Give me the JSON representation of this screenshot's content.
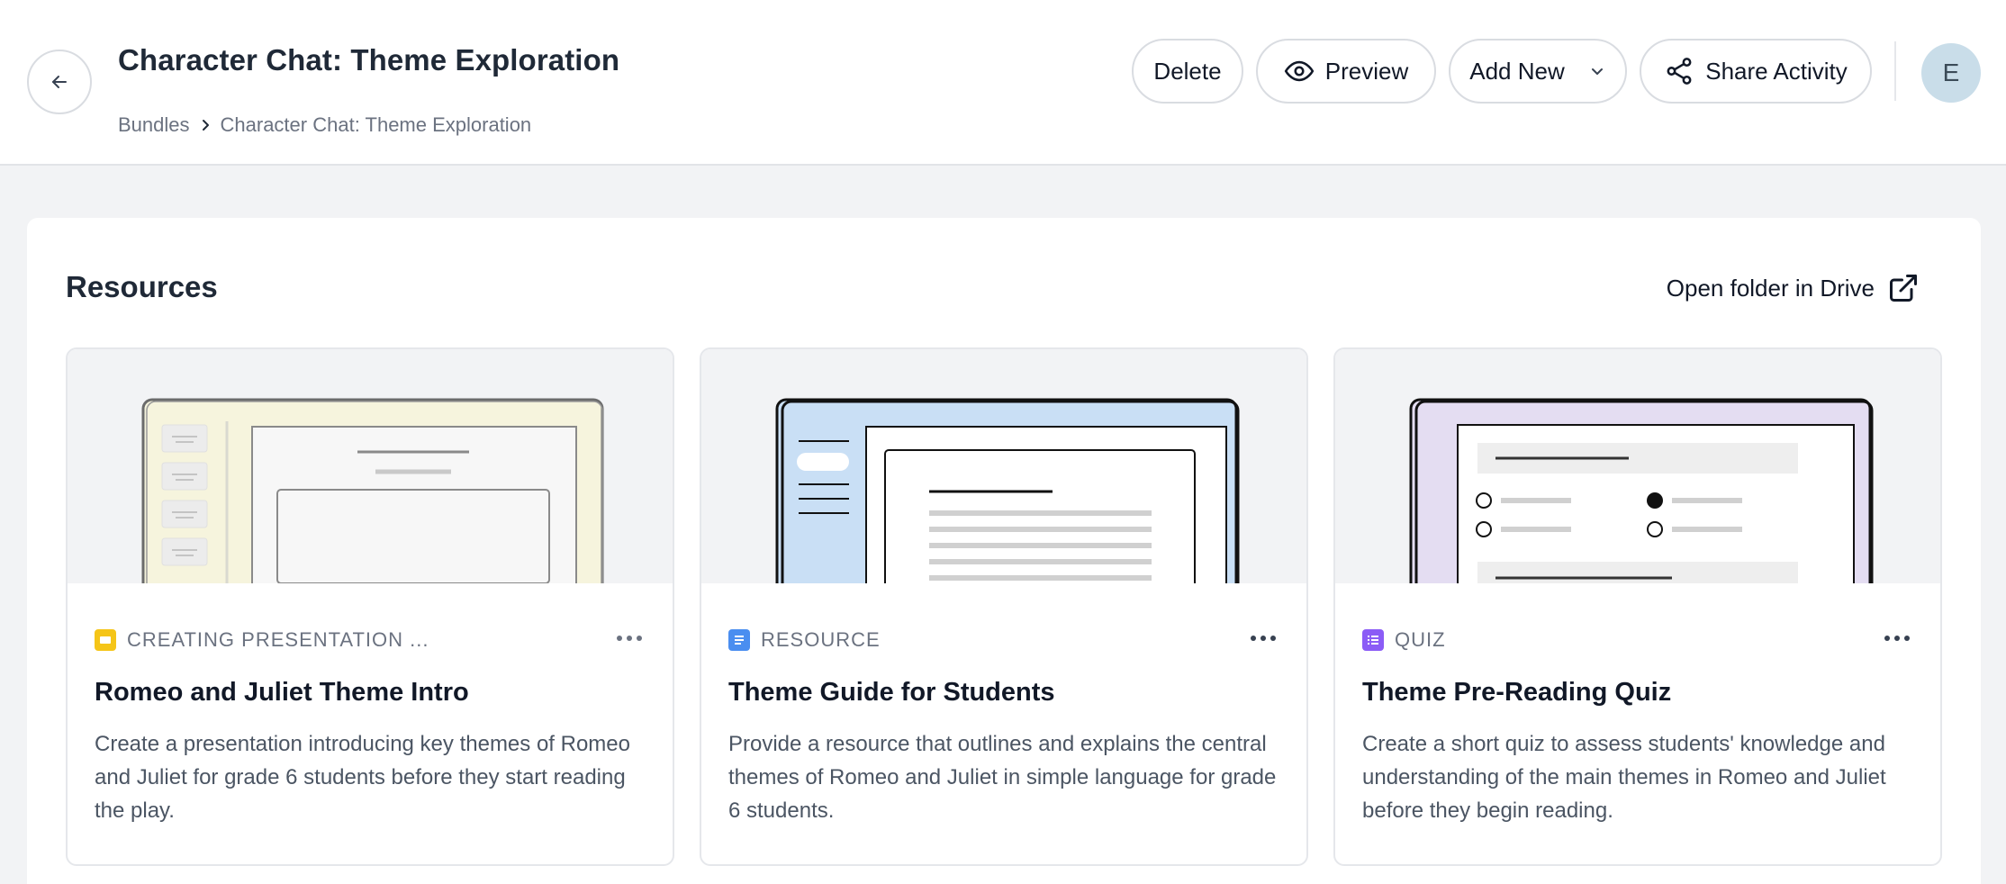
{
  "header": {
    "title": "Character Chat: Theme Exploration",
    "breadcrumb": [
      "Bundles",
      "Character Chat: Theme Exploration"
    ],
    "actions": {
      "delete_label": "Delete",
      "preview_label": "Preview",
      "add_new_label": "Add New",
      "share_label": "Share Activity"
    },
    "avatar_initial": "E"
  },
  "resources": {
    "title": "Resources",
    "open_drive_label": "Open folder in Drive",
    "cards": [
      {
        "type_label": "CREATING PRESENTATION ...",
        "type_icon": "slides-icon",
        "type_color": "#f5c518",
        "thumb_color": "#f6f4dd",
        "title": "Romeo and Juliet Theme Intro",
        "description": "Create a presentation introducing key themes of Romeo and Juliet for grade 6 students before they start reading the play."
      },
      {
        "type_label": "RESOURCE",
        "type_icon": "document-icon",
        "type_color": "#4a8ef0",
        "thumb_color": "#c9dff5",
        "title": "Theme Guide for Students",
        "description": "Provide a resource that outlines and explains the central themes of Romeo and Juliet in simple language for grade 6 students."
      },
      {
        "type_label": "QUIZ",
        "type_icon": "quiz-icon",
        "type_color": "#8b5cf6",
        "thumb_color": "#e4ddf2",
        "title": "Theme Pre-Reading Quiz",
        "description": "Create a short quiz to assess students' knowledge and understanding of the main themes in Romeo and Juliet before they begin reading."
      }
    ]
  }
}
